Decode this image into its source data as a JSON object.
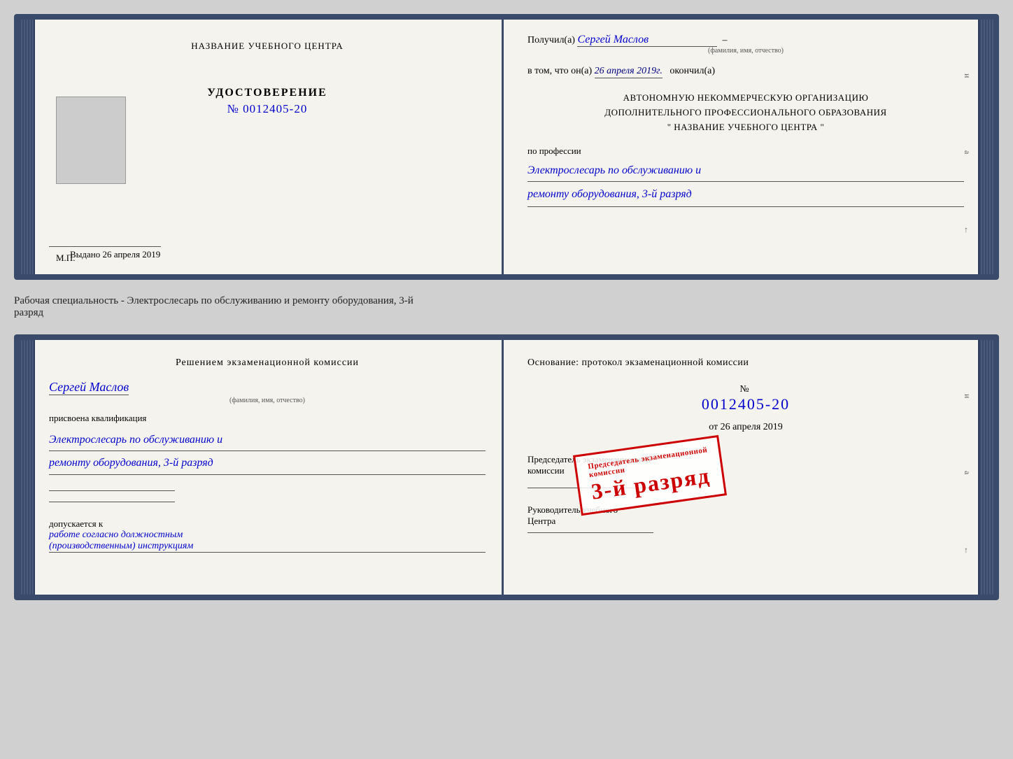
{
  "card1": {
    "left": {
      "org_name": "НАЗВАНИЕ УЧЕБНОГО ЦЕНТРА",
      "cert_title": "УДОСТОВЕРЕНИЕ",
      "cert_number_prefix": "№",
      "cert_number": "0012405-20",
      "issued_label": "Выдано",
      "issued_date": "26 апреля 2019",
      "mp_label": "М.П."
    },
    "right": {
      "received_prefix": "Получил(а)",
      "received_name": "Сергей Маслов",
      "name_subtitle": "(фамилия, имя, отчество)",
      "dash": "–",
      "date_prefix": "в том, что он(а)",
      "date_value": "26 апреля 2019г.",
      "date_suffix": "окончил(а)",
      "org_line1": "АВТОНОМНУЮ НЕКОММЕРЧЕСКУЮ ОРГАНИЗАЦИЮ",
      "org_line2": "ДОПОЛНИТЕЛЬНОГО ПРОФЕССИОНАЛЬНОГО ОБРАЗОВАНИЯ",
      "org_line3": "\"    НАЗВАНИЕ УЧЕБНОГО ЦЕНТРА    \"",
      "profession_prefix": "по профессии",
      "profession_line1": "Электрослесарь по обслуживанию и",
      "profession_line2": "ремонту оборудования, 3-й разряд"
    }
  },
  "between_text": "Рабочая специальность - Электрослесарь по обслуживанию и ремонту оборудования, 3-й\nразряд",
  "card2": {
    "left": {
      "decision_title": "Решением  экзаменационной  комиссии",
      "person_name": "Сергей Маслов",
      "name_subtitle": "(фамилия, имя, отчество)",
      "qualification_prefix": "присвоена квалификация",
      "qual_line1": "Электрослесарь по обслуживанию и",
      "qual_line2": "ремонту оборудования, 3-й разряд",
      "допускается_prefix": "допускается к",
      "допускается_hw": "работе согласно должностным\n(производственным) инструкциям"
    },
    "right": {
      "basis_text": "Основание: протокол экзаменационной  комиссии",
      "number_prefix": "№",
      "number_value": "0012405-20",
      "date_prefix": "от",
      "date_value": "26 апреля 2019",
      "commission_head": "Председатель экзаменационной комиссии",
      "leader_label": "Руководитель учебного\nЦентра"
    },
    "stamp": {
      "line1": "Председатель экзаменационной",
      "line2": "комиссии",
      "main": "3-й разряд"
    }
  }
}
